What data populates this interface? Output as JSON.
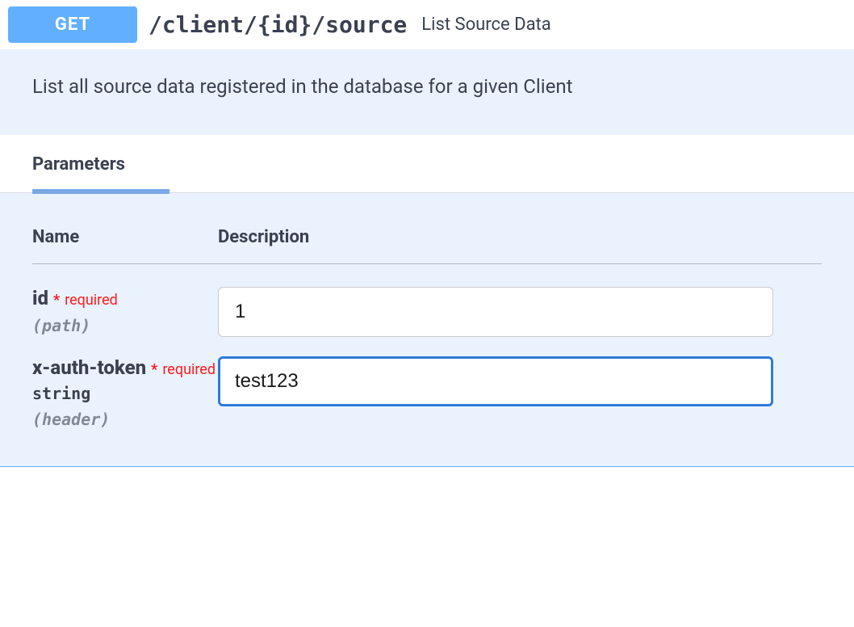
{
  "endpoint": {
    "method": "GET",
    "path": "/client/{id}/source",
    "summary": "List Source Data",
    "description": "List all source data registered in the database for a given Client"
  },
  "tabs": {
    "parameters": "Parameters"
  },
  "table": {
    "nameHeader": "Name",
    "descHeader": "Description",
    "requiredLabel": "required",
    "star": "*"
  },
  "params": [
    {
      "name": "id",
      "required": true,
      "type": "",
      "in": "(path)",
      "value": "1",
      "focused": false
    },
    {
      "name": "x-auth-token",
      "required": true,
      "type": "string",
      "in": "(header)",
      "value": "test123",
      "focused": true
    }
  ]
}
